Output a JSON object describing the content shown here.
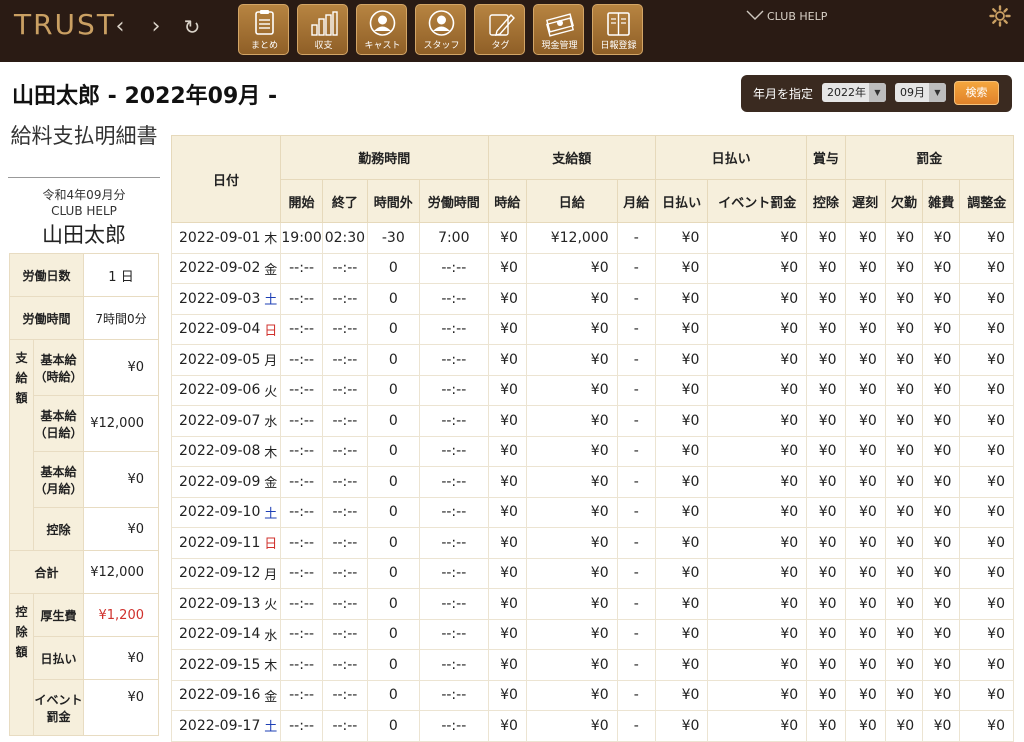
{
  "header": {
    "logo": "TRUST",
    "nav": {
      "back": "‹",
      "forward": "›",
      "reload": "↻"
    },
    "menu": [
      {
        "label": "まとめ",
        "icon": "clipboard-icon"
      },
      {
        "label": "収支",
        "icon": "bar-chart-icon"
      },
      {
        "label": "キャスト",
        "icon": "person-icon"
      },
      {
        "label": "スタッフ",
        "icon": "person-icon"
      },
      {
        "label": "タグ",
        "icon": "pencil-icon"
      },
      {
        "label": "現金管理",
        "icon": "cash-icon"
      },
      {
        "label": "日報登録",
        "icon": "book-icon"
      }
    ],
    "club_help": "CLUB HELP",
    "settings_icon": "gear-icon"
  },
  "page": {
    "title": "山田太郎 - 2022年09月 -"
  },
  "filter": {
    "label": "年月を指定",
    "year": "2022年",
    "month": "09月",
    "search": "検索"
  },
  "left_panel": {
    "title": "給料支払明細書",
    "date": "令和4年09月分",
    "club": "CLUB HELP",
    "name": "山田太郎",
    "work_days_label": "労働日数",
    "work_days": "1 日",
    "work_hours_label": "労働時間",
    "work_hours": "7時間0分",
    "pay_group": "支給額",
    "base_hourly_label": "基本給（時給）",
    "base_hourly": "¥0",
    "base_daily_label": "基本給（日給）",
    "base_daily": "¥12,000",
    "base_monthly_label": "基本給（月給）",
    "base_monthly": "¥0",
    "deduction_label": "控除",
    "deduction": "¥0",
    "total_label": "合計",
    "total": "¥12,000",
    "deduct_group": "控除額",
    "welfare_label": "厚生費",
    "welfare": "¥1,200",
    "daily_advance_label": "日払い",
    "daily_advance": "¥0",
    "event_fine_label": "イベント罰金",
    "event_fine": "¥0"
  },
  "table": {
    "group_headers": {
      "date": "日付",
      "work_time": "勤務時間",
      "pay": "支給額",
      "advance": "日払い",
      "bonus": "賞与",
      "fine": "罰金"
    },
    "columns": [
      "開始",
      "終了",
      "時間外",
      "労働時間",
      "時給",
      "日給",
      "月給",
      "日払い",
      "イベント罰金",
      "控除",
      "遅刻",
      "欠勤",
      "雑費",
      "調整金"
    ],
    "rows": [
      {
        "date": "2022-09-01",
        "dow": "木",
        "start": "19:00",
        "end": "02:30",
        "overtime": "-30",
        "work": "7:00",
        "hourly": "¥0",
        "daily": "¥12,000",
        "monthly": "-",
        "advance": "¥0",
        "event_fine": "¥0",
        "deduct": "¥0",
        "late": "¥0",
        "absent": "¥0",
        "misc": "¥0",
        "adjust": "¥0"
      },
      {
        "date": "2022-09-02",
        "dow": "金",
        "start": "--:--",
        "end": "--:--",
        "overtime": "0",
        "work": "--:--",
        "hourly": "¥0",
        "daily": "¥0",
        "monthly": "-",
        "advance": "¥0",
        "event_fine": "¥0",
        "deduct": "¥0",
        "late": "¥0",
        "absent": "¥0",
        "misc": "¥0",
        "adjust": "¥0"
      },
      {
        "date": "2022-09-03",
        "dow": "土",
        "start": "--:--",
        "end": "--:--",
        "overtime": "0",
        "work": "--:--",
        "hourly": "¥0",
        "daily": "¥0",
        "monthly": "-",
        "advance": "¥0",
        "event_fine": "¥0",
        "deduct": "¥0",
        "late": "¥0",
        "absent": "¥0",
        "misc": "¥0",
        "adjust": "¥0"
      },
      {
        "date": "2022-09-04",
        "dow": "日",
        "start": "--:--",
        "end": "--:--",
        "overtime": "0",
        "work": "--:--",
        "hourly": "¥0",
        "daily": "¥0",
        "monthly": "-",
        "advance": "¥0",
        "event_fine": "¥0",
        "deduct": "¥0",
        "late": "¥0",
        "absent": "¥0",
        "misc": "¥0",
        "adjust": "¥0"
      },
      {
        "date": "2022-09-05",
        "dow": "月",
        "start": "--:--",
        "end": "--:--",
        "overtime": "0",
        "work": "--:--",
        "hourly": "¥0",
        "daily": "¥0",
        "monthly": "-",
        "advance": "¥0",
        "event_fine": "¥0",
        "deduct": "¥0",
        "late": "¥0",
        "absent": "¥0",
        "misc": "¥0",
        "adjust": "¥0"
      },
      {
        "date": "2022-09-06",
        "dow": "火",
        "start": "--:--",
        "end": "--:--",
        "overtime": "0",
        "work": "--:--",
        "hourly": "¥0",
        "daily": "¥0",
        "monthly": "-",
        "advance": "¥0",
        "event_fine": "¥0",
        "deduct": "¥0",
        "late": "¥0",
        "absent": "¥0",
        "misc": "¥0",
        "adjust": "¥0"
      },
      {
        "date": "2022-09-07",
        "dow": "水",
        "start": "--:--",
        "end": "--:--",
        "overtime": "0",
        "work": "--:--",
        "hourly": "¥0",
        "daily": "¥0",
        "monthly": "-",
        "advance": "¥0",
        "event_fine": "¥0",
        "deduct": "¥0",
        "late": "¥0",
        "absent": "¥0",
        "misc": "¥0",
        "adjust": "¥0"
      },
      {
        "date": "2022-09-08",
        "dow": "木",
        "start": "--:--",
        "end": "--:--",
        "overtime": "0",
        "work": "--:--",
        "hourly": "¥0",
        "daily": "¥0",
        "monthly": "-",
        "advance": "¥0",
        "event_fine": "¥0",
        "deduct": "¥0",
        "late": "¥0",
        "absent": "¥0",
        "misc": "¥0",
        "adjust": "¥0"
      },
      {
        "date": "2022-09-09",
        "dow": "金",
        "start": "--:--",
        "end": "--:--",
        "overtime": "0",
        "work": "--:--",
        "hourly": "¥0",
        "daily": "¥0",
        "monthly": "-",
        "advance": "¥0",
        "event_fine": "¥0",
        "deduct": "¥0",
        "late": "¥0",
        "absent": "¥0",
        "misc": "¥0",
        "adjust": "¥0"
      },
      {
        "date": "2022-09-10",
        "dow": "土",
        "start": "--:--",
        "end": "--:--",
        "overtime": "0",
        "work": "--:--",
        "hourly": "¥0",
        "daily": "¥0",
        "monthly": "-",
        "advance": "¥0",
        "event_fine": "¥0",
        "deduct": "¥0",
        "late": "¥0",
        "absent": "¥0",
        "misc": "¥0",
        "adjust": "¥0"
      },
      {
        "date": "2022-09-11",
        "dow": "日",
        "start": "--:--",
        "end": "--:--",
        "overtime": "0",
        "work": "--:--",
        "hourly": "¥0",
        "daily": "¥0",
        "monthly": "-",
        "advance": "¥0",
        "event_fine": "¥0",
        "deduct": "¥0",
        "late": "¥0",
        "absent": "¥0",
        "misc": "¥0",
        "adjust": "¥0"
      },
      {
        "date": "2022-09-12",
        "dow": "月",
        "start": "--:--",
        "end": "--:--",
        "overtime": "0",
        "work": "--:--",
        "hourly": "¥0",
        "daily": "¥0",
        "monthly": "-",
        "advance": "¥0",
        "event_fine": "¥0",
        "deduct": "¥0",
        "late": "¥0",
        "absent": "¥0",
        "misc": "¥0",
        "adjust": "¥0"
      },
      {
        "date": "2022-09-13",
        "dow": "火",
        "start": "--:--",
        "end": "--:--",
        "overtime": "0",
        "work": "--:--",
        "hourly": "¥0",
        "daily": "¥0",
        "monthly": "-",
        "advance": "¥0",
        "event_fine": "¥0",
        "deduct": "¥0",
        "late": "¥0",
        "absent": "¥0",
        "misc": "¥0",
        "adjust": "¥0"
      },
      {
        "date": "2022-09-14",
        "dow": "水",
        "start": "--:--",
        "end": "--:--",
        "overtime": "0",
        "work": "--:--",
        "hourly": "¥0",
        "daily": "¥0",
        "monthly": "-",
        "advance": "¥0",
        "event_fine": "¥0",
        "deduct": "¥0",
        "late": "¥0",
        "absent": "¥0",
        "misc": "¥0",
        "adjust": "¥0"
      },
      {
        "date": "2022-09-15",
        "dow": "木",
        "start": "--:--",
        "end": "--:--",
        "overtime": "0",
        "work": "--:--",
        "hourly": "¥0",
        "daily": "¥0",
        "monthly": "-",
        "advance": "¥0",
        "event_fine": "¥0",
        "deduct": "¥0",
        "late": "¥0",
        "absent": "¥0",
        "misc": "¥0",
        "adjust": "¥0"
      },
      {
        "date": "2022-09-16",
        "dow": "金",
        "start": "--:--",
        "end": "--:--",
        "overtime": "0",
        "work": "--:--",
        "hourly": "¥0",
        "daily": "¥0",
        "monthly": "-",
        "advance": "¥0",
        "event_fine": "¥0",
        "deduct": "¥0",
        "late": "¥0",
        "absent": "¥0",
        "misc": "¥0",
        "adjust": "¥0"
      },
      {
        "date": "2022-09-17",
        "dow": "土",
        "start": "--:--",
        "end": "--:--",
        "overtime": "0",
        "work": "--:--",
        "hourly": "¥0",
        "daily": "¥0",
        "monthly": "-",
        "advance": "¥0",
        "event_fine": "¥0",
        "deduct": "¥0",
        "late": "¥0",
        "absent": "¥0",
        "misc": "¥0",
        "adjust": "¥0"
      }
    ]
  },
  "colors": {
    "topbar": "#2a1b14",
    "accent": "#b78441",
    "header_bg": "#f6efdc",
    "saturday": "#1d3fb5",
    "sunday": "#d0312d"
  }
}
